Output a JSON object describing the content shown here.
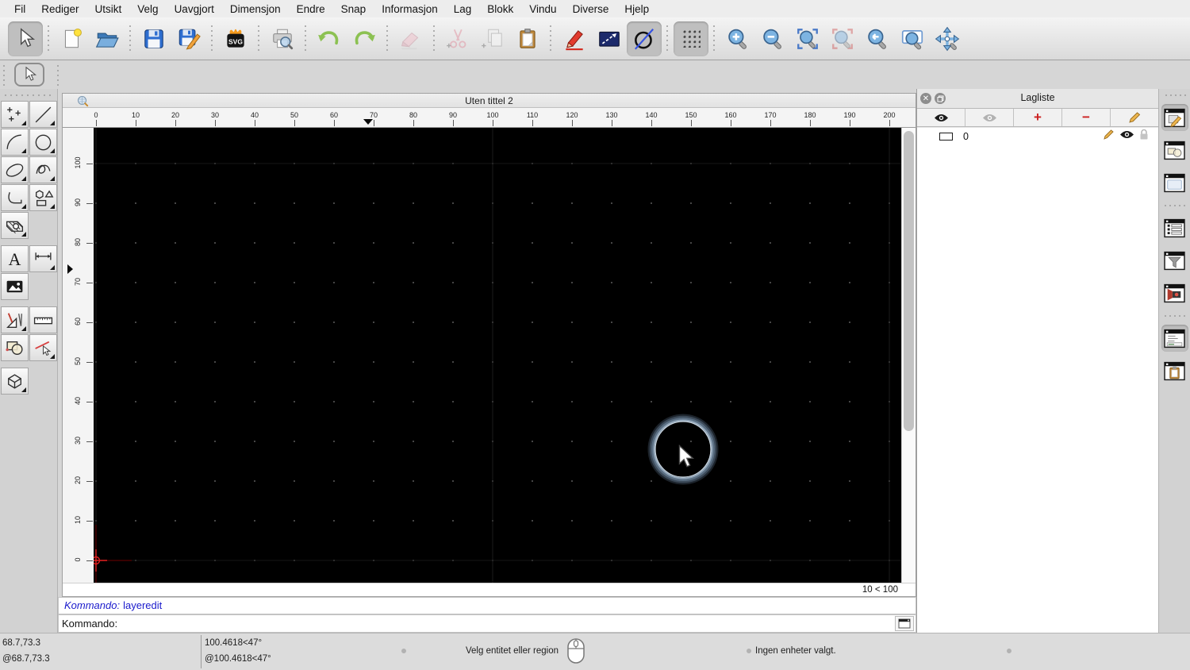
{
  "menu": {
    "items": [
      "Fil",
      "Rediger",
      "Utsikt",
      "Velg",
      "Uavgjort",
      "Dimensjon",
      "Endre",
      "Snap",
      "Informasjon",
      "Lag",
      "Blokk",
      "Vindu",
      "Diverse",
      "Hjelp"
    ]
  },
  "toolbar": {
    "groups": [
      [
        {
          "name": "select",
          "icon": "select-arrow",
          "state": "selected"
        }
      ],
      [
        {
          "name": "new-drawing",
          "icon": "new-drawing"
        },
        {
          "name": "open-drawing",
          "icon": "open-drawing"
        }
      ],
      [
        {
          "name": "save",
          "icon": "save"
        },
        {
          "name": "save-as",
          "icon": "save-as"
        }
      ],
      [
        {
          "name": "export-svg",
          "icon": "export-svg"
        }
      ],
      [
        {
          "name": "print-preview",
          "icon": "print-preview"
        }
      ],
      [
        {
          "name": "undo",
          "icon": "undo"
        },
        {
          "name": "redo",
          "icon": "redo"
        }
      ],
      [
        {
          "name": "eraser",
          "icon": "eraser",
          "state": "disabled"
        }
      ],
      [
        {
          "name": "cut",
          "icon": "cut",
          "state": "disabled"
        },
        {
          "name": "copy",
          "icon": "copy",
          "state": "disabled"
        },
        {
          "name": "paste",
          "icon": "paste"
        }
      ],
      [
        {
          "name": "draw-pencil",
          "icon": "draw-pencil"
        },
        {
          "name": "selection-box",
          "icon": "dashed-rect"
        },
        {
          "name": "construction-circle",
          "icon": "circle-crossed",
          "state": "selected"
        }
      ],
      [
        {
          "name": "grid-toggle",
          "icon": "grid",
          "state": "selected"
        }
      ],
      [
        {
          "name": "zoom-in",
          "icon": "zoom-in"
        },
        {
          "name": "zoom-out",
          "icon": "zoom-out"
        },
        {
          "name": "zoom-auto",
          "icon": "zoom-auto"
        },
        {
          "name": "zoom-selection",
          "icon": "zoom-selection",
          "state": "disabled"
        },
        {
          "name": "zoom-previous",
          "icon": "zoom-previous"
        },
        {
          "name": "zoom-window",
          "icon": "zoom-window"
        },
        {
          "name": "pan",
          "icon": "pan"
        }
      ]
    ]
  },
  "tool_options": {
    "current_tool": "select-arrow"
  },
  "palette": {
    "rows": [
      {
        "cells": [
          "points",
          "line"
        ]
      },
      {
        "cells": [
          "arc",
          "circle"
        ]
      },
      {
        "cells": [
          "ellipse",
          "spline"
        ]
      },
      {
        "cells": [
          "polyline",
          "shapes"
        ]
      },
      {
        "cells": [
          "hatch",
          null
        ]
      },
      {
        "cells": [
          "text",
          "dimension"
        ],
        "gap": true
      },
      {
        "cells": [
          "image",
          null
        ]
      },
      {
        "cells": [
          "modify",
          "measure"
        ],
        "gap": true
      },
      {
        "cells": [
          "region",
          "edit-entity"
        ]
      },
      {
        "cells": [
          "solid",
          null
        ],
        "gap": true
      }
    ],
    "flyout": [
      "points",
      "line",
      "arc",
      "circle",
      "ellipse",
      "spline",
      "polyline",
      "shapes",
      "hatch",
      "dimension",
      "modify",
      "edit-entity",
      "solid"
    ]
  },
  "document": {
    "title": "Uten tittel 2",
    "grid_status": "10 < 100",
    "ruler": {
      "h_labels": [
        "0",
        "10",
        "20",
        "30",
        "40",
        "50",
        "60",
        "70",
        "80",
        "90",
        "100",
        "110",
        "120",
        "130",
        "140",
        "150",
        "160",
        "170",
        "180",
        "190",
        "200"
      ],
      "v_labels": [
        "100",
        "90",
        "80",
        "70",
        "60",
        "50",
        "40",
        "30",
        "20",
        "10",
        "0"
      ]
    }
  },
  "layer_panel": {
    "title": "Lagliste",
    "toolbar": [
      {
        "name": "show-all-layers",
        "icon": "eye-open"
      },
      {
        "name": "hide-all-layers",
        "icon": "eye-closed"
      },
      {
        "name": "add-layer",
        "icon": "plus"
      },
      {
        "name": "remove-layer",
        "icon": "minus"
      },
      {
        "name": "edit-layer",
        "icon": "pencil"
      }
    ],
    "layers": [
      {
        "name": "0",
        "visible": true,
        "locked": false
      }
    ]
  },
  "dock": {
    "buttons": [
      {
        "name": "layer-list-panel",
        "selected": true
      },
      {
        "name": "block-list-panel"
      },
      {
        "name": "library-browser-panel"
      },
      {
        "name": "property-editor-panel",
        "sep_before": true
      },
      {
        "name": "selection-filter-panel"
      },
      {
        "name": "view-list-panel"
      },
      {
        "name": "command-line-panel",
        "selected": true,
        "sep_before": true
      },
      {
        "name": "clipboard-panel"
      }
    ]
  },
  "command": {
    "history_label": "Kommando:",
    "history_value": "layeredit",
    "prompt": "Kommando:"
  },
  "status": {
    "abs_coord": "68.7,73.3",
    "rel_coord": "@68.7,73.3",
    "abs_polar": "100.4618<47°",
    "rel_polar": "@100.4618<47°",
    "hint": "Velg entitet eller region",
    "selection": "Ingen enheter valgt."
  },
  "colors": {
    "canvas_bg": "#000000",
    "command_text": "#1a1acc",
    "layer_action_red": "#cc1f1f",
    "origin_cross": "#e02020",
    "selection_glow": "#8aa0b6"
  }
}
